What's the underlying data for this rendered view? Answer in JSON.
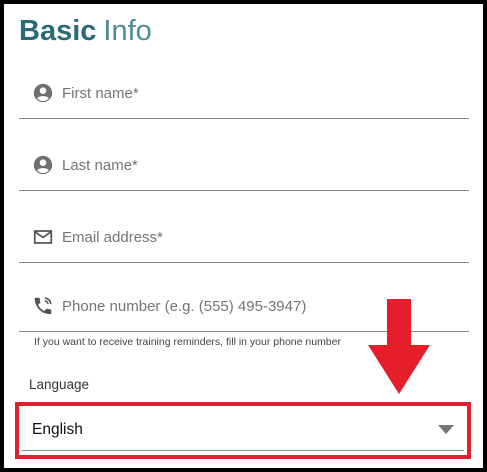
{
  "header": {
    "title_bold": "Basic",
    "title_light": "Info"
  },
  "fields": [
    {
      "icon": "person-icon",
      "placeholder": "First name*"
    },
    {
      "icon": "person-icon",
      "placeholder": "Last name*"
    },
    {
      "icon": "mail-icon",
      "placeholder": "Email address*"
    },
    {
      "icon": "phone-icon",
      "placeholder": "Phone number (e.g. (555) 495-3947)"
    }
  ],
  "phone_hint": "If you want to receive training reminders, fill in your phone number",
  "language": {
    "label": "Language",
    "selected": "English"
  },
  "colors": {
    "title": "#2b6b77",
    "highlight": "#e0202e",
    "annotation_arrow": "#e61e2a"
  }
}
